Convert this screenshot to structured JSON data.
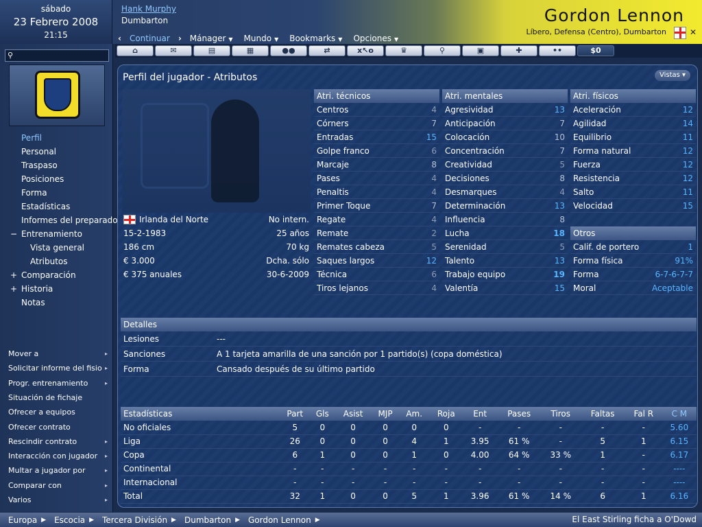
{
  "header": {
    "day": "sábado",
    "date": "23 Febrero 2008",
    "time": "21:15",
    "manager": "Hank Murphy",
    "club": "Dumbarton",
    "player_name": "Gordon Lennon",
    "player_position": "Líbero, Defensa (Centro), Dumbarton"
  },
  "menu": {
    "items": [
      "Continuar",
      "Mánager",
      "Mundo",
      "Bookmarks",
      "Opciones"
    ]
  },
  "toolbar": {
    "items": [
      "home",
      "mail",
      "notebook",
      "calendar",
      "team",
      "transfer",
      "tactics",
      "trophy",
      "search",
      "scout",
      "medical",
      "match",
      "$0"
    ]
  },
  "sidebar": {
    "nav": [
      {
        "label": "Perfil",
        "selected": true
      },
      {
        "label": "Personal"
      },
      {
        "label": "Traspaso"
      },
      {
        "label": "Posiciones"
      },
      {
        "label": "Forma"
      },
      {
        "label": "Estadísticas"
      },
      {
        "label": "Informes del preparador"
      },
      {
        "label": "Entrenamiento",
        "pm": "−"
      },
      {
        "label": "Vista general",
        "sub": true
      },
      {
        "label": "Atributos",
        "sub": true
      },
      {
        "label": "Comparación",
        "pm": "+"
      },
      {
        "label": "Historia",
        "pm": "+"
      },
      {
        "label": "Notas"
      }
    ],
    "actions": [
      {
        "label": "Mover a",
        "arrow": true
      },
      {
        "label": "Solicitar informe del fisio",
        "arrow": true
      },
      {
        "label": "Progr. entrenamiento",
        "arrow": true
      },
      {
        "label": "Situación de fichaje"
      },
      {
        "label": "Ofrecer a equipos"
      },
      {
        "label": "Ofrecer contrato"
      },
      {
        "label": "Rescindir contrato",
        "arrow": true
      },
      {
        "label": "Interacción con jugador",
        "arrow": true
      },
      {
        "label": "Multar a jugador por",
        "arrow": true
      },
      {
        "label": "Comparar con",
        "arrow": true
      },
      {
        "label": "Varios",
        "arrow": true
      }
    ]
  },
  "panel": {
    "title": "Perfil del jugador - Atributos",
    "views_button": "Vistas"
  },
  "bio": [
    [
      "Irlanda del Norte",
      "No intern."
    ],
    [
      "15-2-1983",
      "25 años"
    ],
    [
      "186 cm",
      "70 kg"
    ],
    [
      "€ 3.000",
      "Dcha. sólo"
    ],
    [
      "€ 375 anuales",
      "30-6-2009"
    ]
  ],
  "technical": {
    "title": "Atri. técnicos",
    "rows": [
      [
        "Centros",
        "4"
      ],
      [
        "Córners",
        "7"
      ],
      [
        "Entradas",
        "15"
      ],
      [
        "Golpe franco",
        "6"
      ],
      [
        "Marcaje",
        "8"
      ],
      [
        "Pases",
        "4"
      ],
      [
        "Penaltis",
        "4"
      ],
      [
        "Primer Toque",
        "7"
      ],
      [
        "Regate",
        "4"
      ],
      [
        "Remate",
        "2"
      ],
      [
        "Remates cabeza",
        "5"
      ],
      [
        "Saques largos",
        "12"
      ],
      [
        "Técnica",
        "6"
      ],
      [
        "Tiros lejanos",
        "4"
      ]
    ]
  },
  "mental": {
    "title": "Atri. mentales",
    "rows": [
      [
        "Agresividad",
        "13"
      ],
      [
        "Anticipación",
        "7"
      ],
      [
        "Colocación",
        "10"
      ],
      [
        "Concentración",
        "7"
      ],
      [
        "Creatividad",
        "5"
      ],
      [
        "Decisiones",
        "8"
      ],
      [
        "Desmarques",
        "4"
      ],
      [
        "Determinación",
        "13"
      ],
      [
        "Influencia",
        "8"
      ],
      [
        "Lucha",
        "18"
      ],
      [
        "Serenidad",
        "5"
      ],
      [
        "Talento",
        "13"
      ],
      [
        "Trabajo equipo",
        "19"
      ],
      [
        "Valentía",
        "15"
      ]
    ]
  },
  "physical": {
    "title": "Atri. físicos",
    "rows": [
      [
        "Aceleración",
        "12"
      ],
      [
        "Agilidad",
        "14"
      ],
      [
        "Equilibrio",
        "11"
      ],
      [
        "Forma natural",
        "12"
      ],
      [
        "Fuerza",
        "12"
      ],
      [
        "Resistencia",
        "12"
      ],
      [
        "Salto",
        "11"
      ],
      [
        "Velocidad",
        "15"
      ]
    ]
  },
  "others": {
    "title": "Otros",
    "rows": [
      [
        "Calif. de portero",
        "1"
      ],
      [
        "Forma física",
        "91%"
      ],
      [
        "Forma",
        "6-7-6-7-7"
      ],
      [
        "Moral",
        "Aceptable"
      ]
    ]
  },
  "details": {
    "title": "Detalles",
    "rows": [
      [
        "Lesiones",
        "---"
      ],
      [
        "Sanciones",
        "A 1 tarjeta amarilla de una sanción por 1 partido(s) (copa doméstica)"
      ],
      [
        "Forma",
        "Cansado después de su último partido"
      ]
    ]
  },
  "stats": {
    "headers": [
      "Estadísticas",
      "Part",
      "Gls",
      "Asist",
      "MJP",
      "Am.",
      "Roja",
      "Ent",
      "Pases",
      "Tiros",
      "Faltas",
      "Fal R",
      "C M"
    ],
    "rows": [
      [
        "No oficiales",
        "5",
        "0",
        "0",
        "0",
        "0",
        "0",
        "-",
        "-",
        "-",
        "-",
        "-",
        "5.60"
      ],
      [
        "Liga",
        "26",
        "0",
        "0",
        "0",
        "4",
        "1",
        "3.95",
        "61 %",
        "-",
        "5",
        "1",
        "6.15"
      ],
      [
        "Copa",
        "6",
        "1",
        "0",
        "0",
        "1",
        "0",
        "4.00",
        "64 %",
        "33 %",
        "1",
        "-",
        "6.17"
      ],
      [
        "Continental",
        "-",
        "-",
        "-",
        "-",
        "-",
        "-",
        "-",
        "-",
        "-",
        "-",
        "-",
        "----"
      ],
      [
        "Internacional",
        "-",
        "-",
        "-",
        "-",
        "-",
        "-",
        "-",
        "-",
        "-",
        "-",
        "-",
        "----"
      ],
      [
        "Total",
        "32",
        "1",
        "0",
        "0",
        "5",
        "1",
        "3.96",
        "61 %",
        "14 %",
        "6",
        "1",
        "6.16"
      ]
    ]
  },
  "breadcrumb": [
    "Europa",
    "Escocia",
    "Tercera División",
    "Dumbarton",
    "Gordon Lennon"
  ],
  "news": "El East Stirling ficha a O'Dowd"
}
